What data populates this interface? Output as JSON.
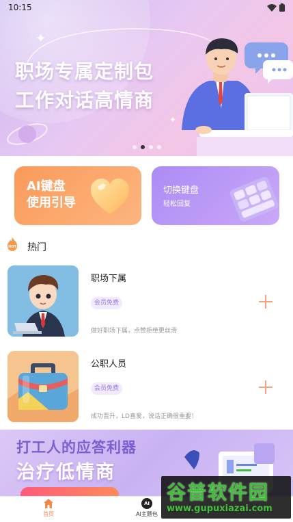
{
  "status_bar": {
    "time": "10:15"
  },
  "hero": {
    "title_line1": "职场专属定制包",
    "title_line2": "工作对话高情商",
    "carousel_pages": 4,
    "carousel_active_index": 1
  },
  "feature_cards": {
    "ai_keyboard": {
      "line1": "AI键盘",
      "line2": "使用引导"
    },
    "switch_keyboard": {
      "title": "切换键盘",
      "subtitle": "轻松回复"
    }
  },
  "hot_section": {
    "badge": "HOT",
    "title": "热门",
    "items": [
      {
        "title": "职场下属",
        "badge": "会员免费",
        "description": "做好职场下属，点赞拒绝更丝滑"
      },
      {
        "title": "公职人员",
        "badge": "会员免费",
        "description": "成功晋升，LD喜爱，说话正确很重要！"
      }
    ]
  },
  "promo": {
    "line1": "打工人的应答利器",
    "line2": "治疗低情商"
  },
  "bottom_nav": {
    "home_label": "首页",
    "theme_label": "AI主题包",
    "ai_icon_text": "AI"
  },
  "watermark": {
    "title": "谷普软件园",
    "url": "www.gupuxiazai.com"
  },
  "colors": {
    "accent_orange": "#f08a4b",
    "card_orange": "#fb9a5b",
    "card_purple": "#ac8cf5",
    "badge_text": "#9a7ae0",
    "add_icon": "#f0a57d"
  }
}
